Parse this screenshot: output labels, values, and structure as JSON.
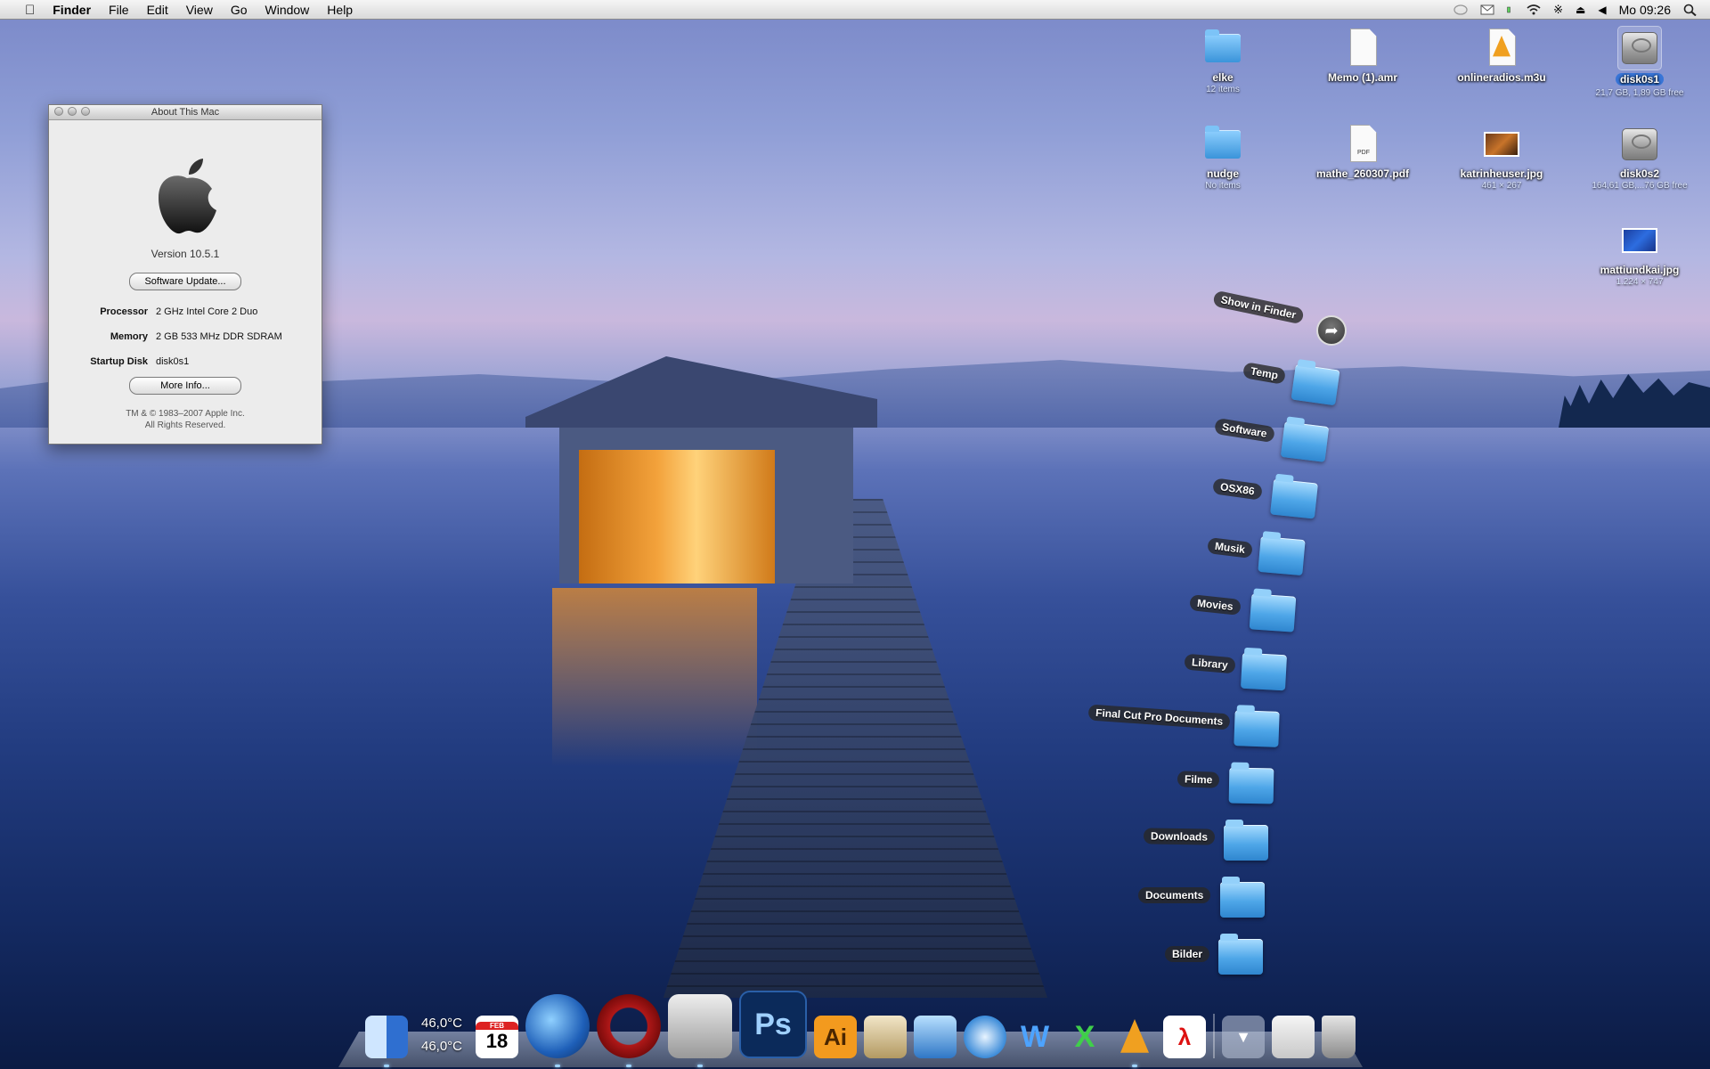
{
  "menubar": {
    "apple_icon": "apple-icon",
    "app": "Finder",
    "menus": [
      "File",
      "Edit",
      "View",
      "Go",
      "Window",
      "Help"
    ],
    "clock": "Mo 09:26",
    "status_icons": [
      "speech-icon",
      "mail-icon",
      "battery-icon",
      "wifi-icon",
      "bluetooth-icon",
      "eject-icon",
      "volume-icon",
      "spotlight-icon"
    ]
  },
  "about_window": {
    "title": "About This Mac",
    "version": "Version 10.5.1",
    "software_update": "Software Update...",
    "processor_label": "Processor",
    "processor": "2 GHz Intel Core 2 Duo",
    "memory_label": "Memory",
    "memory": "2 GB 533 MHz DDR SDRAM",
    "startup_label": "Startup Disk",
    "startup": "disk0s1",
    "more_info": "More Info...",
    "copyright_1": "TM & © 1983–2007 Apple Inc.",
    "copyright_2": "All Rights Reserved."
  },
  "desktop_icons": [
    {
      "name": "elke",
      "sub": "12 items",
      "kind": "folder"
    },
    {
      "name": "Memo (1).amr",
      "sub": "",
      "kind": "document"
    },
    {
      "name": "onlineradios.m3u",
      "sub": "",
      "kind": "vlc-document"
    },
    {
      "name": "disk0s1",
      "sub": "21,7 GB, 1,89 GB free",
      "kind": "disk"
    },
    {
      "name": "nudge",
      "sub": "No items",
      "kind": "folder"
    },
    {
      "name": "mathe_260307.pdf",
      "sub": "",
      "kind": "pdf",
      "tag": "PDF"
    },
    {
      "name": "katrinheuser.jpg",
      "sub": "461 × 267",
      "kind": "photo"
    },
    {
      "name": "disk0s2",
      "sub": "164,61 GB,...76 GB free",
      "kind": "disk"
    },
    {
      "name": "mattiundkai.jpg",
      "sub": "1.224 × 747",
      "kind": "photo"
    }
  ],
  "stack": {
    "show_in_finder": "Show in Finder",
    "items": [
      "Temp",
      "Software",
      "OSX86",
      "Musik",
      "Movies",
      "Library",
      "Final Cut Pro Documents",
      "Filme",
      "Downloads",
      "Documents",
      "Bilder"
    ]
  },
  "dock": {
    "temp1": "46,0°C",
    "temp2": "46,0°C",
    "calendar_month": "FEB",
    "calendar_day": "18",
    "items": [
      "finder-icon",
      "calendar-icon",
      "thunderbird-icon",
      "opera-icon",
      "adium-icon",
      "photoshop-icon",
      "illustrator-icon",
      "preview-icon",
      "iphoto-icon",
      "safari-icon",
      "word-icon",
      "excel-icon",
      "vlc-icon",
      "acrobat-icon",
      "downloads-stack-icon",
      "documents-stack-icon",
      "trash-icon"
    ],
    "ps": "Ps",
    "ai": "Ai"
  }
}
